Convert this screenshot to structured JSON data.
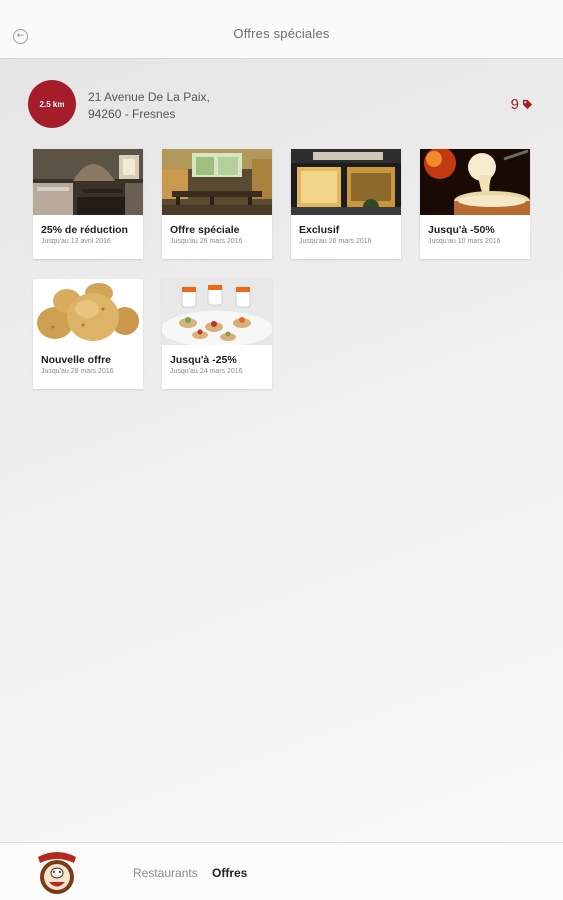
{
  "header": {
    "title": "Offres spéciales",
    "back_icon": "back-arrow-icon"
  },
  "location": {
    "distance": "2.5 km",
    "address_line1": "21 Avenue De La Paix,",
    "address_line2": "94260 - Fresnes",
    "offer_count": "9",
    "offer_icon": "tag-icon"
  },
  "offers": [
    {
      "title": "25% de réduction",
      "subtitle": "Jusqu'au 13 avril 2016",
      "image": "restaurant-interior"
    },
    {
      "title": "Offre spéciale",
      "subtitle": "Jusqu'au 29 mars 2016",
      "image": "dining-room"
    },
    {
      "title": "Exclusif",
      "subtitle": "Jusqu'au 26 mars 2016",
      "image": "restaurant-facade"
    },
    {
      "title": "Jusqu'à -50%",
      "subtitle": "Jusqu'au 10 mars 2016",
      "image": "raclette-cheese"
    },
    {
      "title": "Nouvelle offre",
      "subtitle": "Jusqu'au 28 mars 2016",
      "image": "potatoes"
    },
    {
      "title": "Jusqu'à -25%",
      "subtitle": "Jusqu'au 24 mars 2016",
      "image": "appetizers"
    }
  ],
  "bottom_nav": {
    "logo": "restaurant-logo",
    "tabs": [
      {
        "label": "Restaurants",
        "active": false
      },
      {
        "label": "Offres",
        "active": true
      }
    ]
  },
  "colors": {
    "accent": "#a51c2b",
    "background": "#efefef"
  }
}
